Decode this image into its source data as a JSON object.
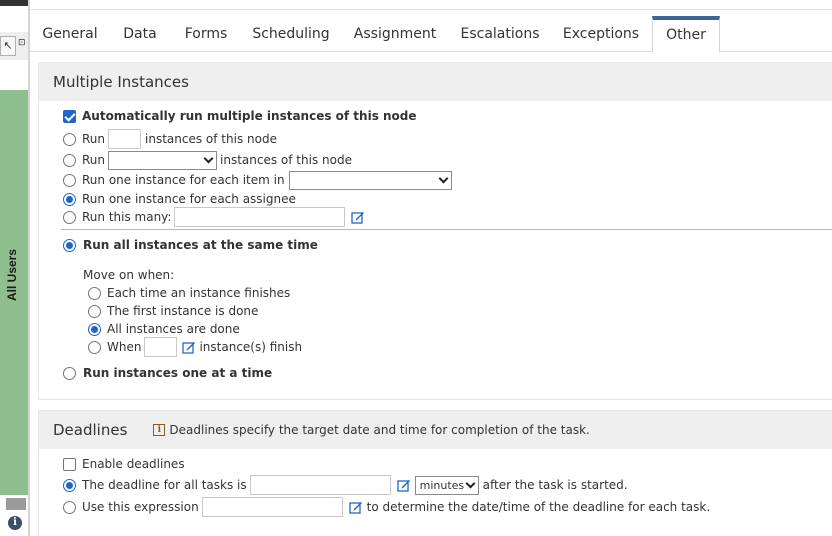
{
  "rail": {
    "label": "All Users"
  },
  "tabs": [
    {
      "label": "General"
    },
    {
      "label": "Data"
    },
    {
      "label": "Forms"
    },
    {
      "label": "Scheduling"
    },
    {
      "label": "Assignment"
    },
    {
      "label": "Escalations"
    },
    {
      "label": "Exceptions"
    },
    {
      "label": "Other"
    }
  ],
  "active_tab": "Other",
  "multiple_instances": {
    "title": "Multiple Instances",
    "auto_run_label": "Automatically run multiple instances of this node",
    "auto_run_checked": true,
    "run_label": "Run",
    "instances_of_node": "instances of this node",
    "run_one_each_item": "Run one instance for each item in",
    "run_one_each_assignee": "Run one instance for each assignee",
    "run_this_many": "Run this many:",
    "selected_option": "Run one instance for each assignee",
    "run_all_same_time": "Run all instances at the same time",
    "move_on_when": "Move on when:",
    "each_time_finishes": "Each time an instance finishes",
    "first_done": "The first instance is done",
    "all_done": "All instances are done",
    "when_label": "When",
    "instances_finish": "instance(s) finish",
    "run_one_at_a_time": "Run instances one at a time"
  },
  "deadlines": {
    "title": "Deadlines",
    "info_text": "Deadlines specify the target date and time for completion of the task.",
    "enable_label": "Enable deadlines",
    "enable_checked": false,
    "deadline_all_tasks": "The deadline for all tasks is",
    "unit_value": "minutes",
    "after_started": "after the task is started.",
    "use_expression": "Use this expression",
    "to_determine": "to determine the date/time of the deadline for each task."
  },
  "colors": {
    "accent": "#1f66c9",
    "tab_indicator": "#3a6595",
    "rail_green": "#8fbf8f"
  }
}
